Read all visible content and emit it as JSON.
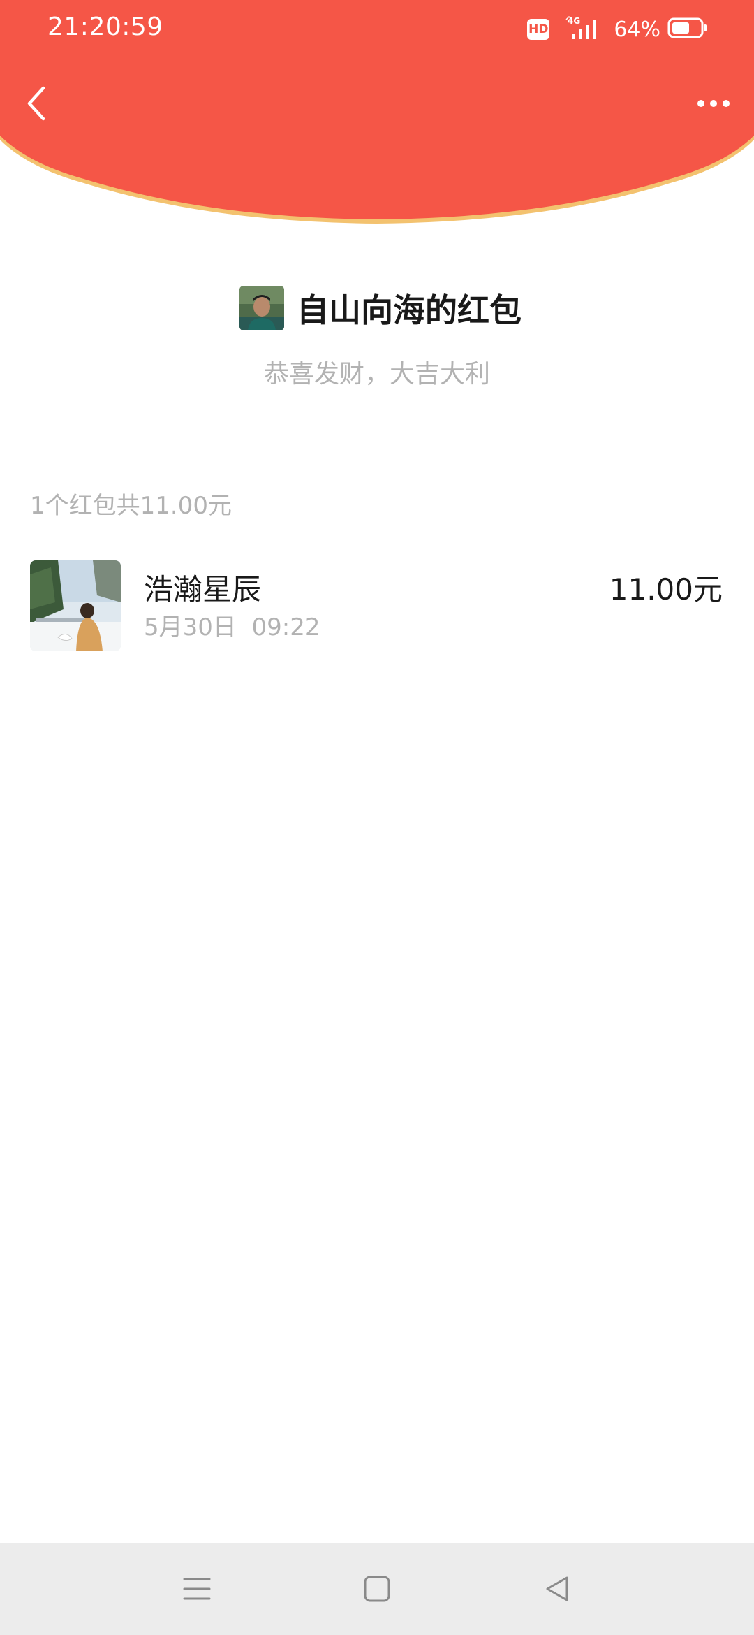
{
  "status_bar": {
    "time": "21:20:59",
    "hd_label": "HD",
    "network_label": "4G",
    "battery_percent": "64%",
    "battery_level": 0.64
  },
  "header": {
    "background_color": "#f55647",
    "rim_color": "#f3c26f",
    "back_icon": "chevron-left-icon",
    "more_icon": "more-dots-icon"
  },
  "packet": {
    "sender_title": "自山向海的红包",
    "blessing": "恭喜发财，大吉大利"
  },
  "summary": {
    "text": "1个红包共11.00元"
  },
  "receivers": [
    {
      "name": "浩瀚星辰",
      "time": "5月30日  09:22",
      "amount": "11.00元"
    }
  ],
  "bottom_nav": {
    "menu_icon": "menu-icon",
    "home_icon": "home-square-icon",
    "back_icon": "back-triangle-icon"
  }
}
